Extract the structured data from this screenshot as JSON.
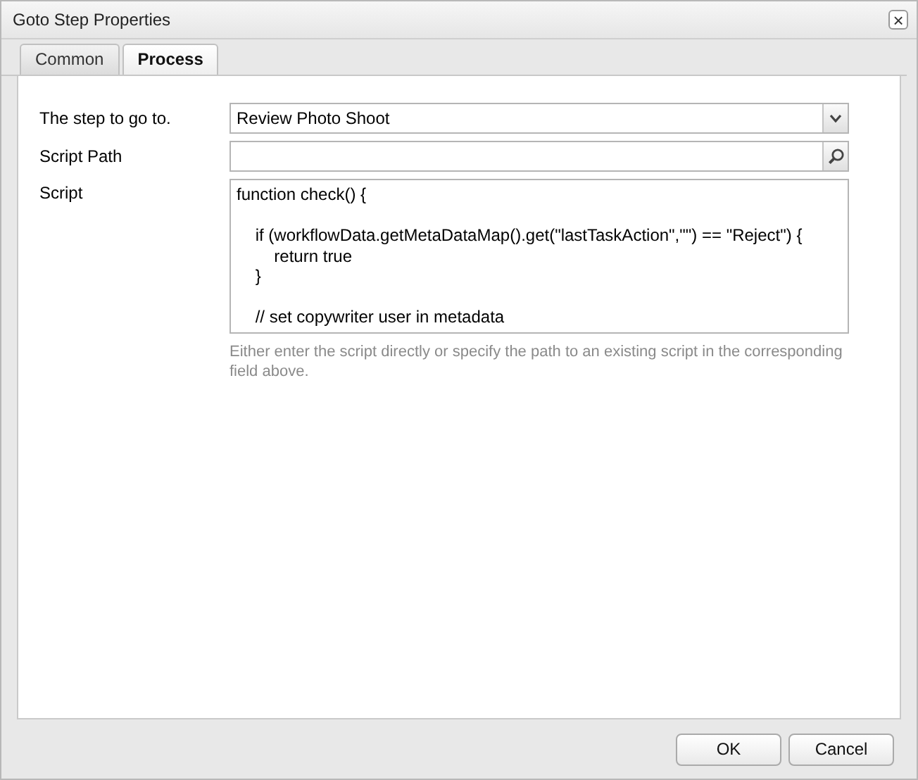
{
  "window": {
    "title": "Goto Step Properties",
    "close": "×"
  },
  "tabs": [
    {
      "label": "Common",
      "selected": false
    },
    {
      "label": "Process",
      "selected": true
    }
  ],
  "form": {
    "step": {
      "label": "The step to go to.",
      "value": "Review Photo Shoot"
    },
    "script_path": {
      "label": "Script Path"
    },
    "script": {
      "label": "Script",
      "value": "function check() {\n\n    if (workflowData.getMetaDataMap().get(\"lastTaskAction\",\"\") == \"Reject\") {\n        return true\n    }\n\n    // set copywriter user in metadata",
      "help": "Either enter the script directly or specify the path to an existing script in the corresponding field above."
    }
  },
  "buttons": [
    "OK",
    "Cancel"
  ]
}
